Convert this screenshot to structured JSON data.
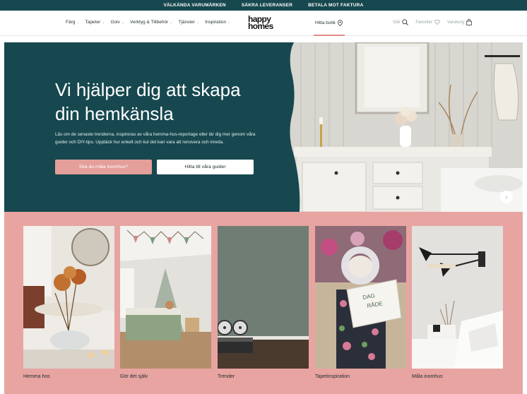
{
  "topbar": {
    "items": [
      "VÄLKÄNDA VARUMÄRKEN",
      "SÄKRA LEVERANSER",
      "BETALA MOT FAKTURA"
    ]
  },
  "nav": {
    "menu": [
      "Färg",
      "Tapeter",
      "Golv",
      "Verktyg & Tillbehör",
      "Tjänster",
      "Inspiration"
    ],
    "logo": [
      "happy",
      "homes"
    ],
    "store": "Hitta butik",
    "tools": {
      "search": "Sök",
      "favorites": "Favoriter",
      "cart": "Varukorg"
    }
  },
  "hero": {
    "title_line1": "Vi hjälper dig att skapa",
    "title_line2": "din hemkänsla",
    "text": "Läs om de senaste trenderna, inspireras av våra hemma-hos-reportage eller lär dig mer genom våra guider och DIY-tips. Upptäck hur enkelt och kul det kan vara att renovera och inreda.",
    "button_primary": "Ska du måla inomhus?",
    "button_secondary": "Hitta till våra guider"
  },
  "categories": [
    {
      "label": "Hemma hos"
    },
    {
      "label": "Gör det själv"
    },
    {
      "label": "Trender"
    },
    {
      "label": "Tapetinspiration"
    },
    {
      "label": "Måla inomhus"
    }
  ],
  "colors": {
    "teal": "#17484f",
    "pink": "#e8a4a1",
    "accent": "#e08b86"
  },
  "icons": [
    "chevron-down-icon",
    "map-pin-icon",
    "search-icon",
    "heart-icon",
    "bag-icon",
    "arrow-left-icon",
    "arrow-right-icon"
  ]
}
